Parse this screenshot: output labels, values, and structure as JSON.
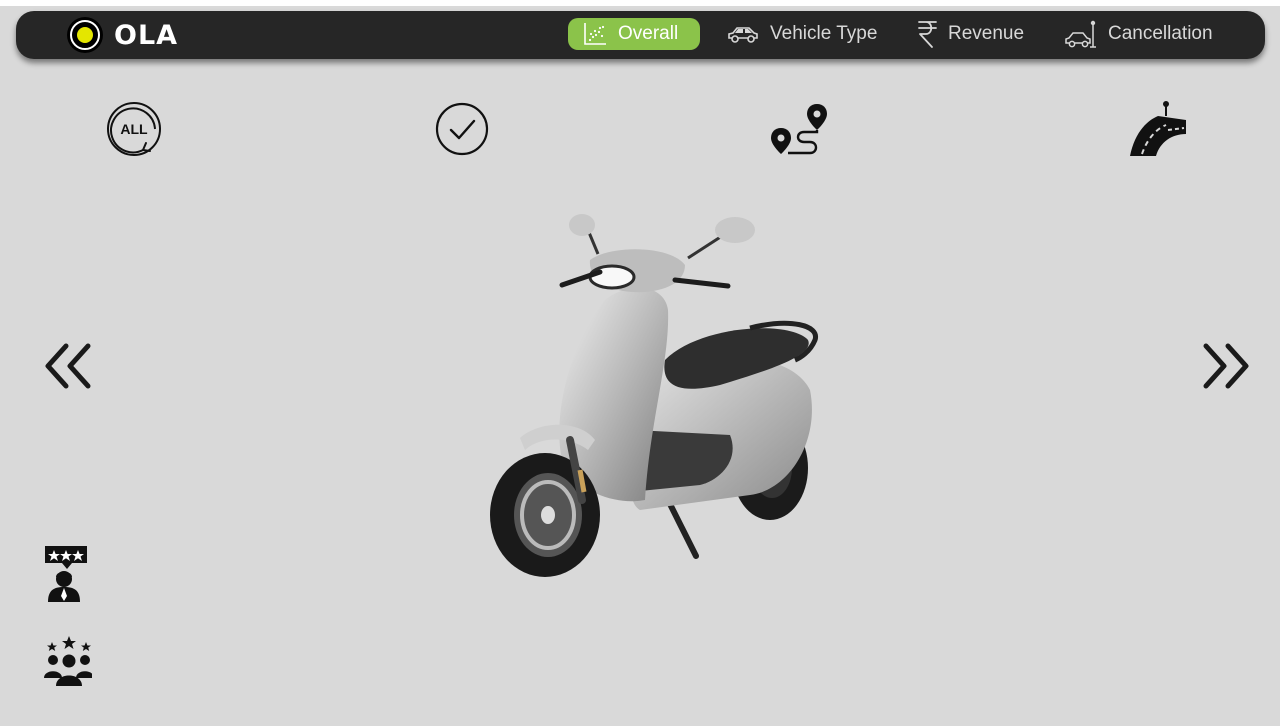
{
  "brand": {
    "name": "OLA",
    "accent": "#e4e600"
  },
  "nav": {
    "active_color": "#8bc34a",
    "items": [
      {
        "label": "Overall",
        "icon": "scatter-chart-icon",
        "active": true
      },
      {
        "label": "Vehicle Type",
        "icon": "car-icon",
        "active": false
      },
      {
        "label": "Revenue",
        "icon": "rupee-icon",
        "active": false
      },
      {
        "label": "Cancellation",
        "icon": "cancel-car-icon",
        "active": false
      }
    ]
  },
  "filters": [
    {
      "icon": "all-icon",
      "text": "ALL"
    },
    {
      "icon": "check-circle-icon"
    },
    {
      "icon": "route-icon"
    },
    {
      "icon": "road-icon"
    }
  ],
  "carousel": {
    "prev_icon": "chevron-double-left-icon",
    "next_icon": "chevron-double-right-icon",
    "image": "scooter-image"
  },
  "side_icons": [
    {
      "icon": "driver-rating-icon"
    },
    {
      "icon": "customer-rating-icon"
    }
  ]
}
